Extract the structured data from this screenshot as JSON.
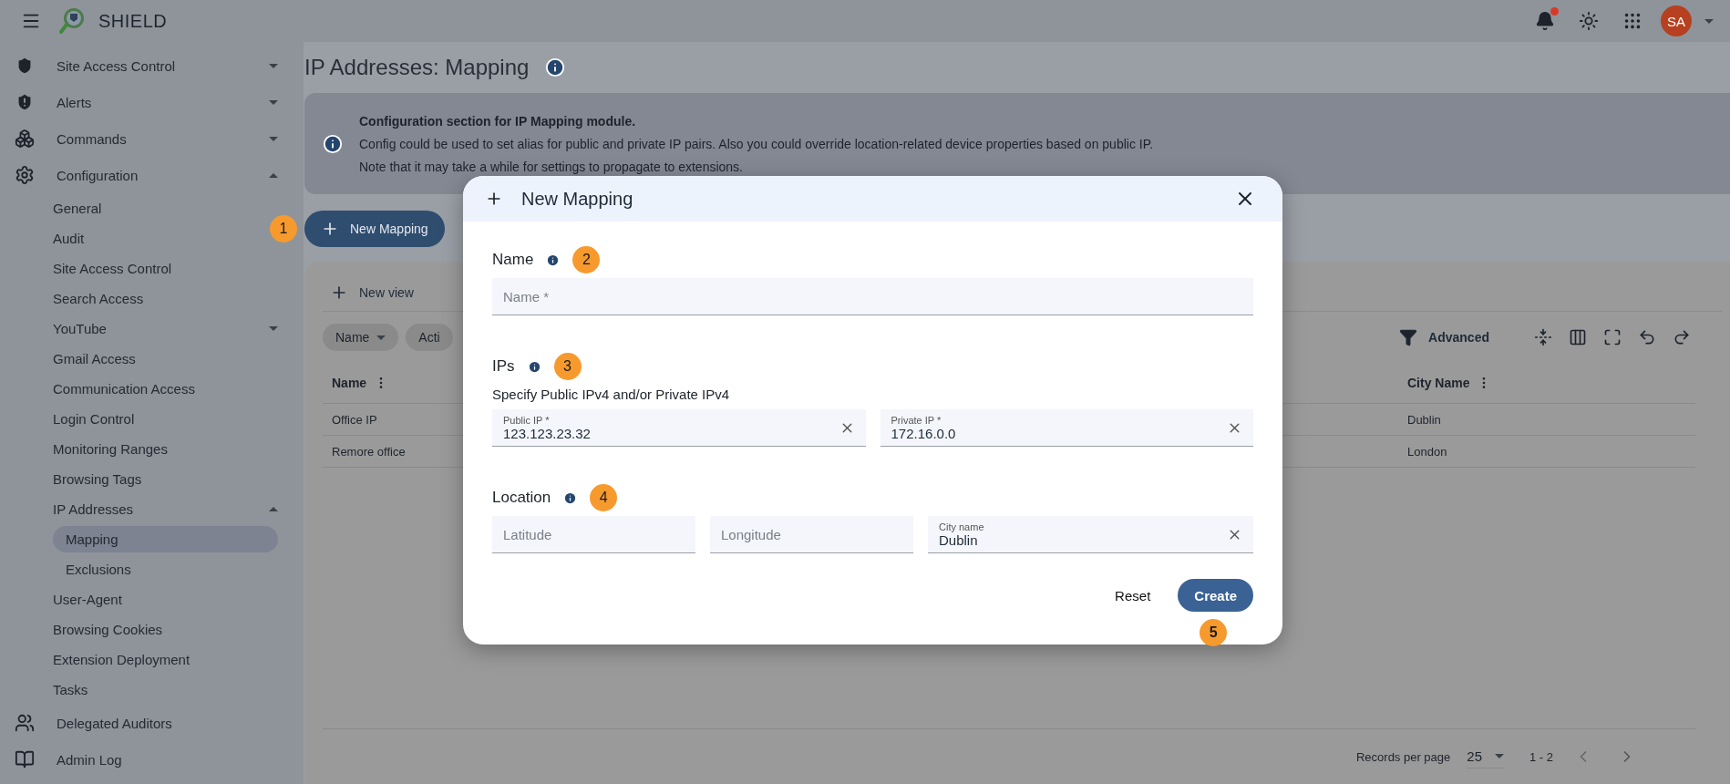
{
  "header": {
    "app_name": "SHIELD",
    "notifications_unread": true,
    "avatar": "SA"
  },
  "sidebar": {
    "items": [
      {
        "label": "Site Access Control",
        "expanded": false,
        "selected": false
      },
      {
        "label": "Alerts",
        "expanded": false,
        "selected": false
      },
      {
        "label": "Commands",
        "expanded": false,
        "selected": false
      },
      {
        "label": "Configuration",
        "expanded": true,
        "selected": false,
        "children": [
          {
            "label": "General",
            "selected": false
          },
          {
            "label": "Audit",
            "selected": false
          },
          {
            "label": "Site Access Control",
            "selected": false
          },
          {
            "label": "Search Access",
            "selected": false
          },
          {
            "label": "YouTube",
            "expanded": false,
            "selected": false
          },
          {
            "label": "Gmail Access",
            "selected": false
          },
          {
            "label": "Communication Access",
            "selected": false
          },
          {
            "label": "Login Control",
            "selected": false
          },
          {
            "label": "Monitoring Ranges",
            "selected": false
          },
          {
            "label": "Browsing Tags",
            "selected": false
          },
          {
            "label": "IP Addresses",
            "expanded": true,
            "selected": false,
            "children": [
              {
                "label": "Mapping",
                "selected": true
              },
              {
                "label": "Exclusions",
                "selected": false
              }
            ]
          },
          {
            "label": "User-Agent",
            "selected": false
          },
          {
            "label": "Browsing Cookies",
            "selected": false
          },
          {
            "label": "Extension Deployment",
            "selected": false
          },
          {
            "label": "Tasks",
            "selected": false
          }
        ]
      },
      {
        "label": "Delegated Auditors",
        "selected": false
      },
      {
        "label": "Admin Log",
        "selected": false
      }
    ]
  },
  "page": {
    "title": "IP Addresses: Mapping",
    "info": {
      "heading": "Configuration section for IP Mapping module.",
      "lines": [
        "Config could be used to set alias for public and private IP pairs. Also you could override location-related device properties based on public IP.",
        "Note that it may take a while for settings to propagate to extensions."
      ]
    },
    "new_button": {
      "label": "New Mapping",
      "step": "1"
    },
    "table": {
      "new_view": "New view",
      "chips": [
        "Name",
        "Acti"
      ],
      "advanced": "Advanced",
      "columns": [
        {
          "label": "Name"
        },
        {
          "label": "City Name"
        }
      ],
      "rows": [
        [
          "Office IP",
          "Dublin"
        ],
        [
          "Remore office",
          "London"
        ]
      ],
      "pagination": {
        "label": "Records per page",
        "per_page": "25",
        "range": "1 - 2"
      }
    }
  },
  "modal": {
    "title": "New Mapping",
    "sections": [
      {
        "title": "Name",
        "step": "2",
        "fields": [
          {
            "placeholder": "Name *"
          }
        ]
      },
      {
        "title": "IPs",
        "step": "3",
        "description": "Specify Public IPv4 and/or Private IPv4",
        "fields": [
          {
            "label": "Public IP *",
            "value": "123.123.23.32",
            "clearable": true
          },
          {
            "label": "Private IP *",
            "value": "172.16.0.0",
            "clearable": true
          }
        ]
      },
      {
        "title": "Location",
        "step": "4",
        "fields": [
          {
            "placeholder": "Latitude"
          },
          {
            "placeholder": "Longitude"
          },
          {
            "label": "City name",
            "value": "Dublin",
            "clearable": true
          }
        ]
      }
    ],
    "reset": "Reset",
    "create": "Create",
    "create_step": "5"
  }
}
